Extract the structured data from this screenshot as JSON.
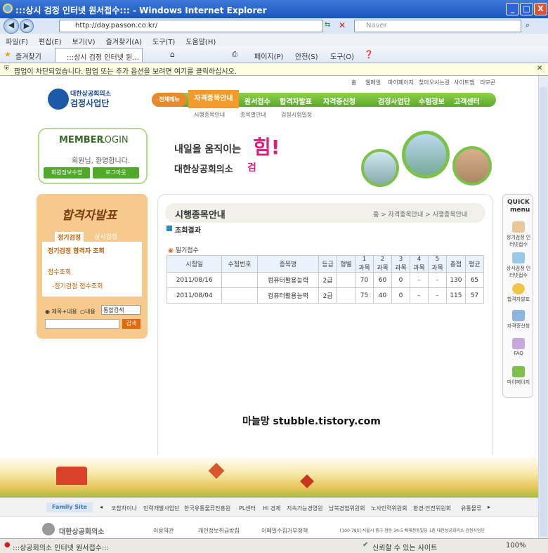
{
  "window": {
    "title": ":::상시 검정 인터넷 원서접수::: - Windows Internet Explorer",
    "min": "_",
    "max": "□",
    "close": "X"
  },
  "address": {
    "url": "http://day.passon.co.kr/",
    "search_placeholder": "Naver"
  },
  "menu": [
    "파일(F)",
    "편집(E)",
    "보기(V)",
    "즐겨찾기(A)",
    "도구(T)",
    "도움말(H)"
  ],
  "favbar": {
    "favorites": "즐겨찾기",
    "tab": ":::상시 검정 인터넷 원...",
    "page": "페이지(P)",
    "safety": "안전(S)",
    "tools": "도구(O)"
  },
  "infobar": "팝업이 차단되었습니다. 팝업 또는 추가 옵션을 보려면 여기를 클릭하십시오.",
  "site": {
    "topnav": [
      "홈",
      "웹메일",
      "마이페이지",
      "찾아오시는길",
      "사이트맵",
      "리모콘"
    ],
    "org": "대한상공회의소",
    "org_sub": "검정사업단",
    "nav": {
      "all": "전체메뉴",
      "active": "자격종목안내",
      "items": [
        "원서접수",
        "합격자발표",
        "자격증신청",
        "검정사업단",
        "수험정보",
        "고객센터"
      ]
    },
    "subnav": [
      "시행종목안내",
      "종목별안내",
      "검정시험일정"
    ],
    "login": {
      "title_a": "MEMBER",
      "title_b": "LOGIN",
      "greet": "회원님, 환영합니다.",
      "edit": "회원정보수정",
      "logout": "로그아웃"
    },
    "banner": {
      "line1": "내일을 움직이는",
      "big": "힘!",
      "line2": "대한상공회의소",
      "line2b": "검"
    },
    "left": {
      "title": "합격자발표",
      "tab1": "정기검정",
      "tab2": "상시검정",
      "link1": "정기검정 합격자 조회",
      "link2": "점수조회",
      "link3": "-정기검정 점수조회",
      "radio1": "제목+내용",
      "radio2": "내용",
      "select": "통합검색",
      "go": "검색"
    },
    "content": {
      "title": "시행종목안내",
      "crumb": "홈 > 자격종목안내 > 시행종목안내",
      "section": "조회결과",
      "sub": "필기점수"
    },
    "table": {
      "headers": [
        "시험일",
        "수험번호",
        "종목명",
        "등급",
        "형별",
        "1\n과목",
        "2\n과목",
        "3\n과목",
        "4\n과목",
        "5\n과목",
        "총점",
        "평균"
      ],
      "rows": [
        [
          "2011/08/16",
          "",
          "컴퓨터활용능력",
          "2급",
          "",
          "70",
          "60",
          "0",
          "-",
          "-",
          "130",
          "65"
        ],
        [
          "2011/08/04",
          "",
          "컴퓨터활용능력",
          "2급",
          "",
          "75",
          "40",
          "0",
          "-",
          "-",
          "115",
          "57"
        ]
      ]
    },
    "watermark": "마늘망 stubble.tistory.com",
    "quick": {
      "title_a": "QUICK",
      "title_b": "menu",
      "items": [
        "정기검정 인터넷접수",
        "상시검정 인터넷접수",
        "합격자발표",
        "자격증신청",
        "FAQ",
        "마이페이지"
      ]
    },
    "family": {
      "label": "Family Site",
      "items": [
        "코참차이나",
        "인력개발사업단",
        "한국유통물류진흥원",
        "PL센터",
        "Hi 경제",
        "지속가능경영원",
        "남북경협위원회",
        "노사인력위원회",
        "환경·안전위원회",
        "유통물류"
      ]
    },
    "footer": {
      "org": "대한상공회의소",
      "links": [
        "이용약관",
        "개인정보취급방침",
        "이메일수집거부정책"
      ],
      "addr": "[100-785] 서울시 중구 정동 34-5 배재정동빌딩 1층 대한상공회의소 검정사업단"
    }
  },
  "status": {
    "text": ":::상공회의소 인터넷 원서접수:::",
    "zone": "신뢰할 수 있는 사이트",
    "zoom": "100%"
  }
}
